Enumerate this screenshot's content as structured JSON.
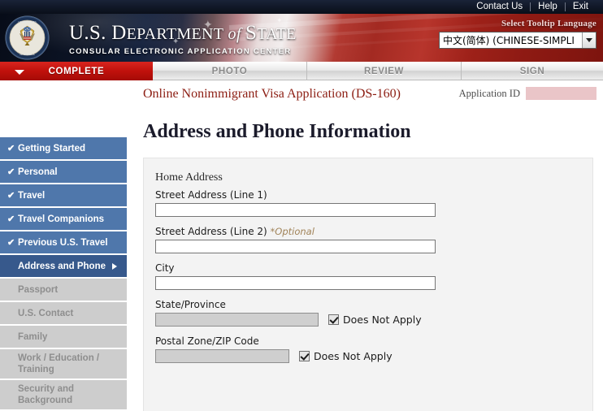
{
  "utility_bar": {
    "links": [
      {
        "label": "Contact Us",
        "name": "contact-us-link"
      },
      {
        "label": "Help",
        "name": "help-link"
      },
      {
        "label": "Exit",
        "name": "exit-link"
      }
    ]
  },
  "masthead": {
    "org_name_parts": {
      "us": "U.S. ",
      "department": "D",
      "department_rest": "EPARTMENT",
      "of": " of ",
      "state": "S",
      "state_rest": "TATE"
    },
    "org_name_full": "U.S. DEPARTMENT of STATE",
    "subtitle": "CONSULAR ELECTRONIC APPLICATION CENTER",
    "seal_icon": "us-great-seal-icon",
    "language": {
      "label": "Select Tooltip Language",
      "selected": "中文(简体)  (CHINESE-SIMPLI",
      "caret_icon": "chevron-down-icon"
    }
  },
  "tabs": [
    {
      "label": "COMPLETE",
      "state": "active",
      "name": "tab-complete"
    },
    {
      "label": "PHOTO",
      "state": "inactive",
      "name": "tab-photo"
    },
    {
      "label": "REVIEW",
      "state": "inactive",
      "name": "tab-review"
    },
    {
      "label": "SIGN",
      "state": "inactive",
      "name": "tab-sign"
    }
  ],
  "app_header": {
    "title": "Online Nonimmigrant Visa Application (DS-160)",
    "application_id_label": "Application ID",
    "application_id_value": ""
  },
  "sidebar": {
    "items": [
      {
        "label": "Getting Started",
        "state": "done",
        "check": "✔"
      },
      {
        "label": "Personal",
        "state": "done",
        "check": "✔"
      },
      {
        "label": "Travel",
        "state": "done",
        "check": "✔"
      },
      {
        "label": "Travel Companions",
        "state": "done",
        "check": "✔"
      },
      {
        "label": "Previous U.S. Travel",
        "state": "done",
        "check": "✔"
      },
      {
        "label": "Address and Phone",
        "state": "current",
        "check": ""
      },
      {
        "label": "Passport",
        "state": "todo",
        "check": ""
      },
      {
        "label": "U.S. Contact",
        "state": "todo",
        "check": ""
      },
      {
        "label": "Family",
        "state": "todo",
        "check": ""
      },
      {
        "label": "Work / Education / Training",
        "state": "todo",
        "check": ""
      },
      {
        "label": "Security and Background",
        "state": "todo",
        "check": ""
      }
    ]
  },
  "main": {
    "page_title": "Address and Phone Information",
    "section_heading": "Home Address",
    "fields": {
      "street1": {
        "label": "Street Address (Line 1)",
        "value": "",
        "optional": ""
      },
      "street2": {
        "label": "Street Address (Line 2) ",
        "value": "",
        "optional": "*Optional"
      },
      "city": {
        "label": "City",
        "value": "",
        "optional": ""
      },
      "state": {
        "label": "State/Province",
        "value": "",
        "disabled": true,
        "checkbox_label": "Does Not Apply",
        "checked": true
      },
      "postal": {
        "label": "Postal Zone/ZIP Code",
        "value": "",
        "disabled": true,
        "checkbox_label": "Does Not Apply",
        "checked": true
      }
    }
  },
  "colors": {
    "brand_red": "#c0110c",
    "nav_done_blue": "#4f77ab",
    "nav_current_blue": "#37598c",
    "nav_todo_grey": "#cdcdcd",
    "app_title_maroon": "#8c1d12",
    "optional_tan": "#a08257",
    "redaction_pink": "#eac5c8"
  }
}
